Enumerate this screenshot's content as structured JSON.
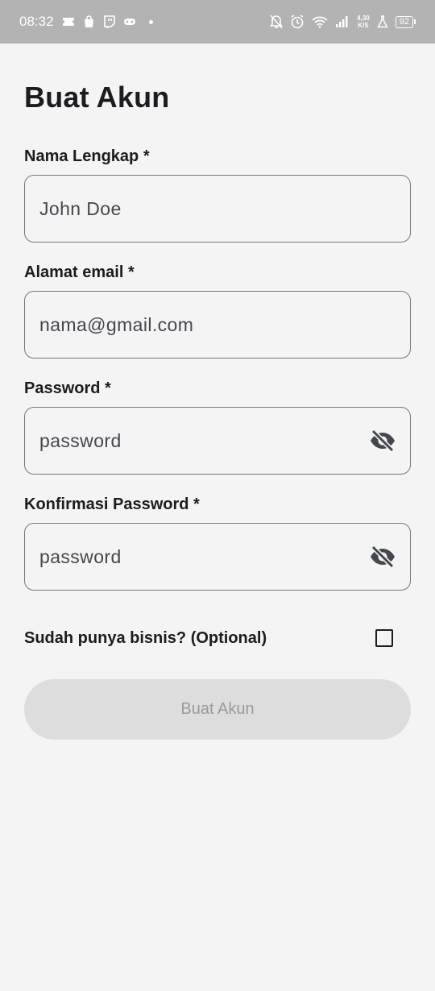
{
  "status_bar": {
    "time": "08:32",
    "net_speed_value": "4,30",
    "net_speed_unit": "K/S",
    "battery": "92"
  },
  "form": {
    "title": "Buat Akun",
    "full_name": {
      "label": "Nama Lengkap *",
      "placeholder": "John Doe"
    },
    "email": {
      "label": "Alamat email *",
      "placeholder": "nama@gmail.com"
    },
    "password": {
      "label": "Password *",
      "placeholder": "password"
    },
    "confirm_password": {
      "label": "Konfirmasi Password *",
      "placeholder": "password"
    },
    "business": {
      "label": "Sudah punya bisnis? (Optional)",
      "checked": false
    },
    "submit_label": "Buat Akun"
  },
  "icons": {
    "password_toggle": "eye-off-icon",
    "confirm_password_toggle": "eye-off-icon"
  },
  "colors": {
    "background": "#f4f4f4",
    "status_bar": "#b3b3b3",
    "border": "#74777f",
    "text": "#1c1b1f",
    "disabled_button": "#dddddd",
    "disabled_button_text": "#9a9a9a"
  }
}
